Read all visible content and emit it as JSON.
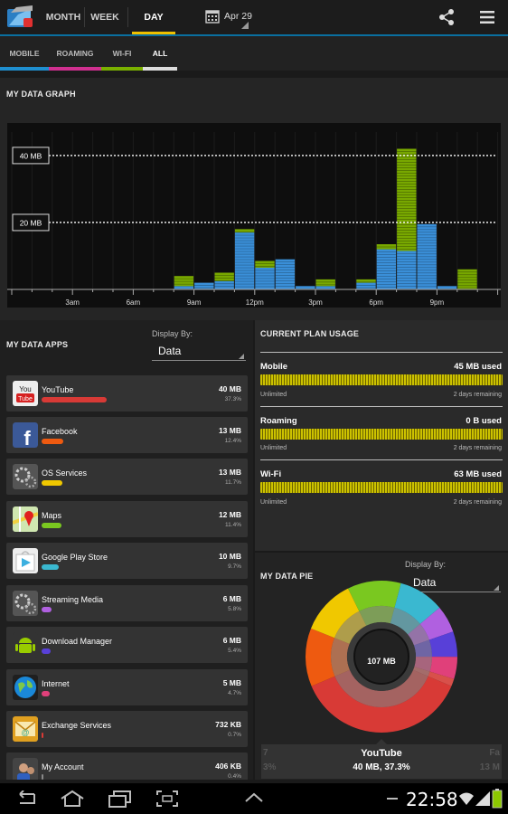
{
  "period_tabs": [
    {
      "label": "MONTH",
      "active": false
    },
    {
      "label": "WEEK",
      "active": false
    },
    {
      "label": "DAY",
      "active": true
    }
  ],
  "date_picker": {
    "label": "Apr 29",
    "icon": "calendar-icon"
  },
  "action_icons": [
    "share-icon",
    "overflow-menu-icon"
  ],
  "network_tabs": [
    {
      "label": "MOBILE",
      "color": "#1f8fd0"
    },
    {
      "label": "ROAMING",
      "color": "#d03090"
    },
    {
      "label": "WI-FI",
      "color": "#7ab000"
    },
    {
      "label": "ALL",
      "color": "#dddddd",
      "active": true
    }
  ],
  "graph": {
    "title": "MY DATA GRAPH",
    "ref_lines": [
      "40 MB",
      "20 MB"
    ],
    "chart_data": {
      "type": "bar",
      "stacked": true,
      "y_unit": "MB",
      "ylim": [
        0,
        47
      ],
      "ref_lines": [
        40,
        20
      ],
      "x_tick_labels": [
        "3am",
        "6am",
        "9am",
        "12pm",
        "3pm",
        "6pm",
        "9pm"
      ],
      "hours": [
        8,
        9,
        10,
        11,
        12,
        13,
        14,
        15,
        16,
        17,
        18,
        19,
        20,
        21,
        22,
        23
      ],
      "series": [
        {
          "name": "Mobile",
          "color": "#3a8fd8",
          "values": [
            1,
            2,
            2.5,
            17,
            6.5,
            9,
            1,
            1,
            0,
            2,
            12,
            11.5,
            19.5,
            1,
            0,
            0
          ]
        },
        {
          "name": "Wi-Fi",
          "color": "#78a800",
          "values": [
            3,
            0,
            2.5,
            1,
            2,
            0,
            0,
            2,
            0,
            1,
            1.5,
            30.5,
            0,
            0,
            6,
            0
          ]
        }
      ]
    }
  },
  "apps": {
    "title": "MY DATA APPS",
    "display_by_label": "Display By:",
    "display_by_value": "Data",
    "items": [
      {
        "name": "YouTube",
        "value": "40 MB",
        "pct": "37.3%",
        "color": "#d83a36",
        "frac": 0.373,
        "icon": "youtube-icon"
      },
      {
        "name": "Facebook",
        "value": "13 MB",
        "pct": "12.4%",
        "color": "#ee5a10",
        "frac": 0.124,
        "icon": "facebook-icon"
      },
      {
        "name": "OS Services",
        "value": "13 MB",
        "pct": "11.7%",
        "color": "#f0c800",
        "frac": 0.117,
        "icon": "gears-icon"
      },
      {
        "name": "Maps",
        "value": "12 MB",
        "pct": "11.4%",
        "color": "#7ac820",
        "frac": 0.114,
        "icon": "maps-icon"
      },
      {
        "name": "Google Play Store",
        "value": "10 MB",
        "pct": "9.7%",
        "color": "#3ab8d0",
        "frac": 0.097,
        "icon": "play-store-icon"
      },
      {
        "name": "Streaming Media",
        "value": "6 MB",
        "pct": "5.8%",
        "color": "#b060e0",
        "frac": 0.058,
        "icon": "gears-icon"
      },
      {
        "name": "Download Manager",
        "value": "6 MB",
        "pct": "5.4%",
        "color": "#5840d8",
        "frac": 0.054,
        "icon": "android-icon"
      },
      {
        "name": "Internet",
        "value": "5 MB",
        "pct": "4.7%",
        "color": "#e0407a",
        "frac": 0.047,
        "icon": "globe-icon"
      },
      {
        "name": "Exchange Services",
        "value": "732 KB",
        "pct": "0.7%",
        "color": "#d83a36",
        "frac": 0.007,
        "icon": "exchange-icon"
      },
      {
        "name": "My Account",
        "value": "406 KB",
        "pct": "0.4%",
        "color": "#888888",
        "frac": 0.004,
        "icon": "account-icon"
      }
    ]
  },
  "plan": {
    "title": "CURRENT PLAN USAGE",
    "items": [
      {
        "name": "Mobile",
        "used": "45 MB used",
        "limit": "Unlimited",
        "remaining": "2 days remaining"
      },
      {
        "name": "Roaming",
        "used": "0 B used",
        "limit": "Unlimited",
        "remaining": "2 days remaining"
      },
      {
        "name": "Wi-Fi",
        "used": "63 MB used",
        "limit": "Unlimited",
        "remaining": "2 days remaining"
      }
    ]
  },
  "pie": {
    "title": "MY DATA PIE",
    "display_by_label": "Display By:",
    "display_by_value": "Data",
    "total": "107 MB",
    "caption": {
      "prev": "7",
      "prev_val": "3%",
      "name": "YouTube",
      "value": "40 MB, 37.3%",
      "next": "Fa",
      "next_val": "13 M"
    },
    "chart_data": {
      "type": "pie",
      "slices": [
        {
          "label": "YouTube",
          "value": 37.3,
          "color": "#d83a36"
        },
        {
          "label": "Facebook",
          "value": 12.4,
          "color": "#ee5a10"
        },
        {
          "label": "OS Services",
          "value": 11.7,
          "color": "#f0c800"
        },
        {
          "label": "Maps",
          "value": 11.4,
          "color": "#7ac820"
        },
        {
          "label": "Google Play Store",
          "value": 9.7,
          "color": "#3ab8d0"
        },
        {
          "label": "Streaming Media",
          "value": 5.8,
          "color": "#b060e0"
        },
        {
          "label": "Download Manager",
          "value": 5.4,
          "color": "#5840d8"
        },
        {
          "label": "Internet",
          "value": 4.7,
          "color": "#e0407a"
        },
        {
          "label": "Other",
          "value": 1.6,
          "color": "#d8504a"
        }
      ]
    }
  },
  "system_bar": {
    "clock": "22:58",
    "battery_color": "#8cc800"
  }
}
